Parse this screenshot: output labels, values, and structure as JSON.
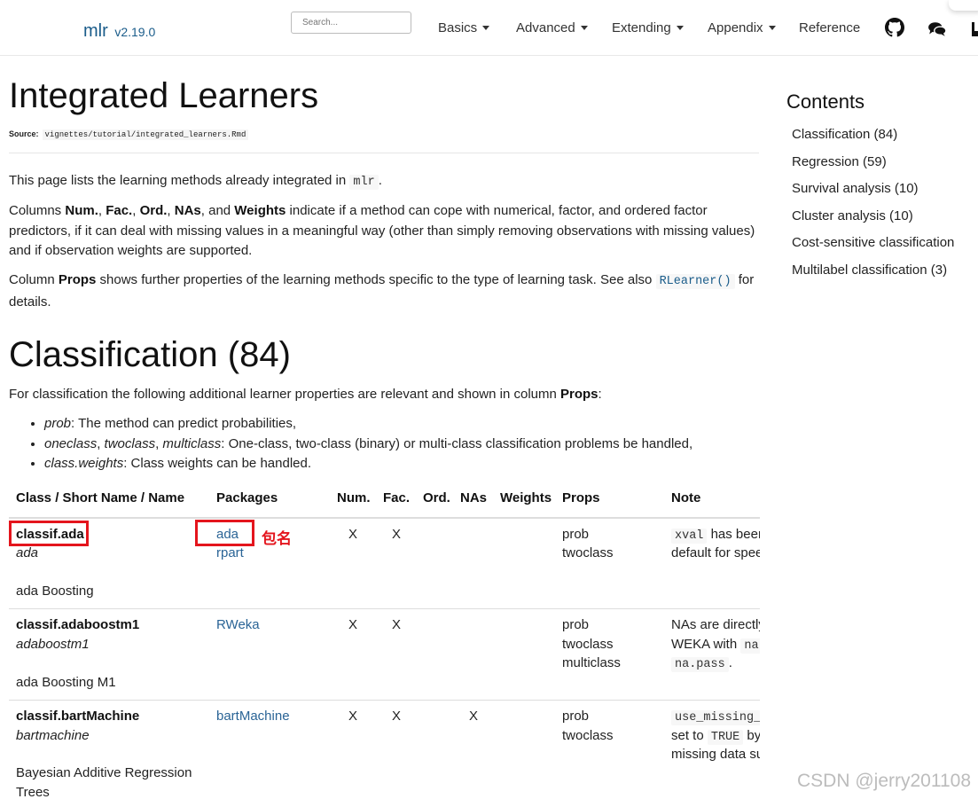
{
  "navbar": {
    "brand": "mlr",
    "version": "v2.19.0",
    "search_placeholder": "Search...",
    "menu": [
      {
        "label": "Basics"
      },
      {
        "label": "Advanced"
      },
      {
        "label": "Extending"
      },
      {
        "label": "Appendix"
      },
      {
        "label": "Reference"
      }
    ],
    "icons": [
      "github-icon",
      "chat-icon",
      "rss-icon"
    ]
  },
  "page": {
    "title": "Integrated Learners",
    "source_label": "Source:",
    "source_path": "vignettes/tutorial/integrated_learners.Rmd",
    "intro": {
      "p1_before": "This page lists the learning methods already integrated in ",
      "p1_code": "mlr",
      "p1_after": ".",
      "p2_t1": "Columns ",
      "p2_b1": "Num.",
      "p2_t2": ", ",
      "p2_b2": "Fac.",
      "p2_t3": ", ",
      "p2_b3": "Ord.",
      "p2_t4": ", ",
      "p2_b4": "NAs",
      "p2_t5": ", and ",
      "p2_b5": "Weights",
      "p2_t6": " indicate if a method can cope with numerical, factor, and ordered factor predictors, if it can deal with missing values in a meaningful way (other than simply removing observations with missing values) and if observation weights are supported.",
      "p3_t1": "Column ",
      "p3_b1": "Props",
      "p3_t2": " shows further properties of the learning methods specific to the type of learning task. See also ",
      "p3_code": "RLearner()",
      "p3_t3": " for details."
    },
    "section_title": "Classification (84)",
    "section_intro_before": "For classification the following additional learner properties are relevant and shown in column ",
    "section_intro_bold": "Props",
    "section_intro_after": ":",
    "props_list": [
      {
        "term": "prob",
        "rest": ": The method can predict probabilities,"
      },
      {
        "term": "oneclass",
        "sep1": ", ",
        "term2": "twoclass",
        "sep2": ", ",
        "term3": "multiclass",
        "rest": ": One-class, two-class (binary) or multi-class classification problems be handled,"
      },
      {
        "term": "class.weights",
        "rest": ": Class weights can be handled."
      }
    ]
  },
  "table": {
    "headers": [
      "Class / Short Name / Name",
      "Packages",
      "Num.",
      "Fac.",
      "Ord.",
      "NAs",
      "Weights",
      "Props",
      "Note"
    ],
    "rows": [
      {
        "class": "classif.ada",
        "short": "ada",
        "name": "ada Boosting",
        "packages": [
          "ada",
          "rpart"
        ],
        "num": "X",
        "fac": "X",
        "ord": "",
        "nas": "",
        "weights": "",
        "props": [
          "prob",
          "twoclass"
        ],
        "note_code": "xval",
        "note_l1": " has been",
        "note_l2": "default for spee"
      },
      {
        "class": "classif.adaboostm1",
        "short": "adaboostm1",
        "name": "ada Boosting M1",
        "packages": [
          "RWeka"
        ],
        "num": "X",
        "fac": "X",
        "ord": "",
        "nas": "",
        "weights": "",
        "props": [
          "prob",
          "twoclass",
          "multiclass"
        ],
        "note_l1": "NAs are directly",
        "note_l2": "WEKA with ",
        "note_l2_code": "na.",
        "note_l3_code": "na.pass",
        "note_l3_after": "."
      },
      {
        "class": "classif.bartMachine",
        "short": "bartmachine",
        "name_l1": "Bayesian Additive Regression",
        "name_l2": "Trees",
        "packages": [
          "bartMachine"
        ],
        "num": "X",
        "fac": "X",
        "ord": "",
        "nas": "X",
        "weights": "",
        "props": [
          "prob",
          "twoclass"
        ],
        "note_code": "use_missing_",
        "note_l2": "set to ",
        "note_l2_code": "TRUE",
        "note_l2_after": " by",
        "note_l3": "missing data su"
      }
    ]
  },
  "annotation": {
    "label": "包名",
    "color": "#e4151d"
  },
  "toc": {
    "title": "Contents",
    "items": [
      "Classification (84)",
      "Regression (59)",
      "Survival analysis (10)",
      "Cluster analysis (10)",
      "Cost-sensitive classification",
      "Multilabel classification (3)"
    ]
  },
  "watermark": "CSDN @jerry201108",
  "colors": {
    "brand": "#1a5c8a",
    "link": "#2a6496",
    "annotation": "#e4151d"
  }
}
